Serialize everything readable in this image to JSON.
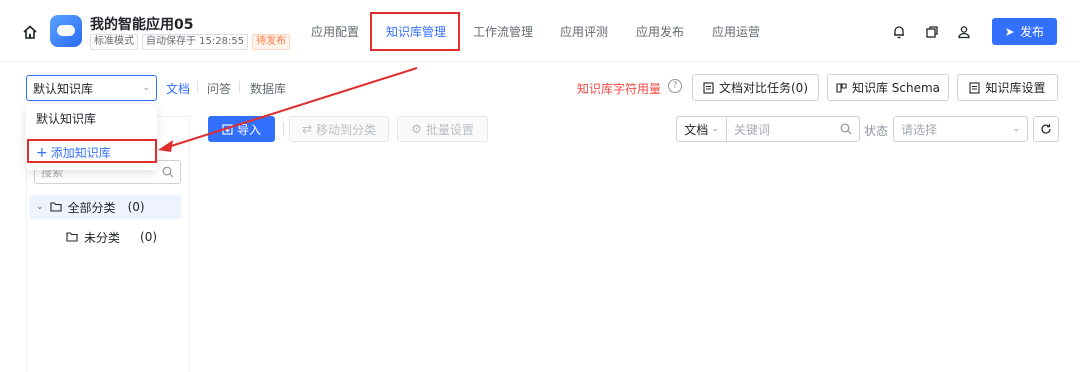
{
  "app": {
    "title": "我的智能应用05",
    "mode_tag": "标准模式",
    "autosave_tag": "自动保存于 15:28:55",
    "status_tag": "待发布"
  },
  "nav": {
    "items": [
      "应用配置",
      "知识库管理",
      "工作流管理",
      "应用评测",
      "应用发布",
      "应用运营"
    ],
    "active_index": 1
  },
  "header_actions": {
    "publish_label": "发布",
    "icons": [
      "bell-icon",
      "copy-icon",
      "user-icon"
    ]
  },
  "kb_selector": {
    "value": "默认知识库"
  },
  "subtabs": [
    "文档",
    "问答",
    "数据库"
  ],
  "right_actions": {
    "usage_label": "知识库字符用量",
    "compare_label": "文档对比任务(0)",
    "schema_label": "知识库 Schema",
    "settings_label": "知识库设置"
  },
  "dropdown": {
    "items": [
      "默认知识库"
    ],
    "add_label": "添加知识库"
  },
  "sidebar": {
    "search_placeholder": "搜索",
    "tree": [
      {
        "label": "全部分类",
        "count": "(0)"
      },
      {
        "label": "未分类",
        "count": "(0)"
      }
    ]
  },
  "toolbar": {
    "import_label": "导入",
    "move_label": "移动到分类",
    "batch_label": "批量设置"
  },
  "filters": {
    "type_value": "文档",
    "keyword_placeholder": "关键词",
    "status_label": "状态",
    "status_placeholder": "请选择"
  },
  "colors": {
    "accent": "#3370ff",
    "annotation_red": "#e02d2d",
    "pending_orange": "#ff7a45"
  }
}
